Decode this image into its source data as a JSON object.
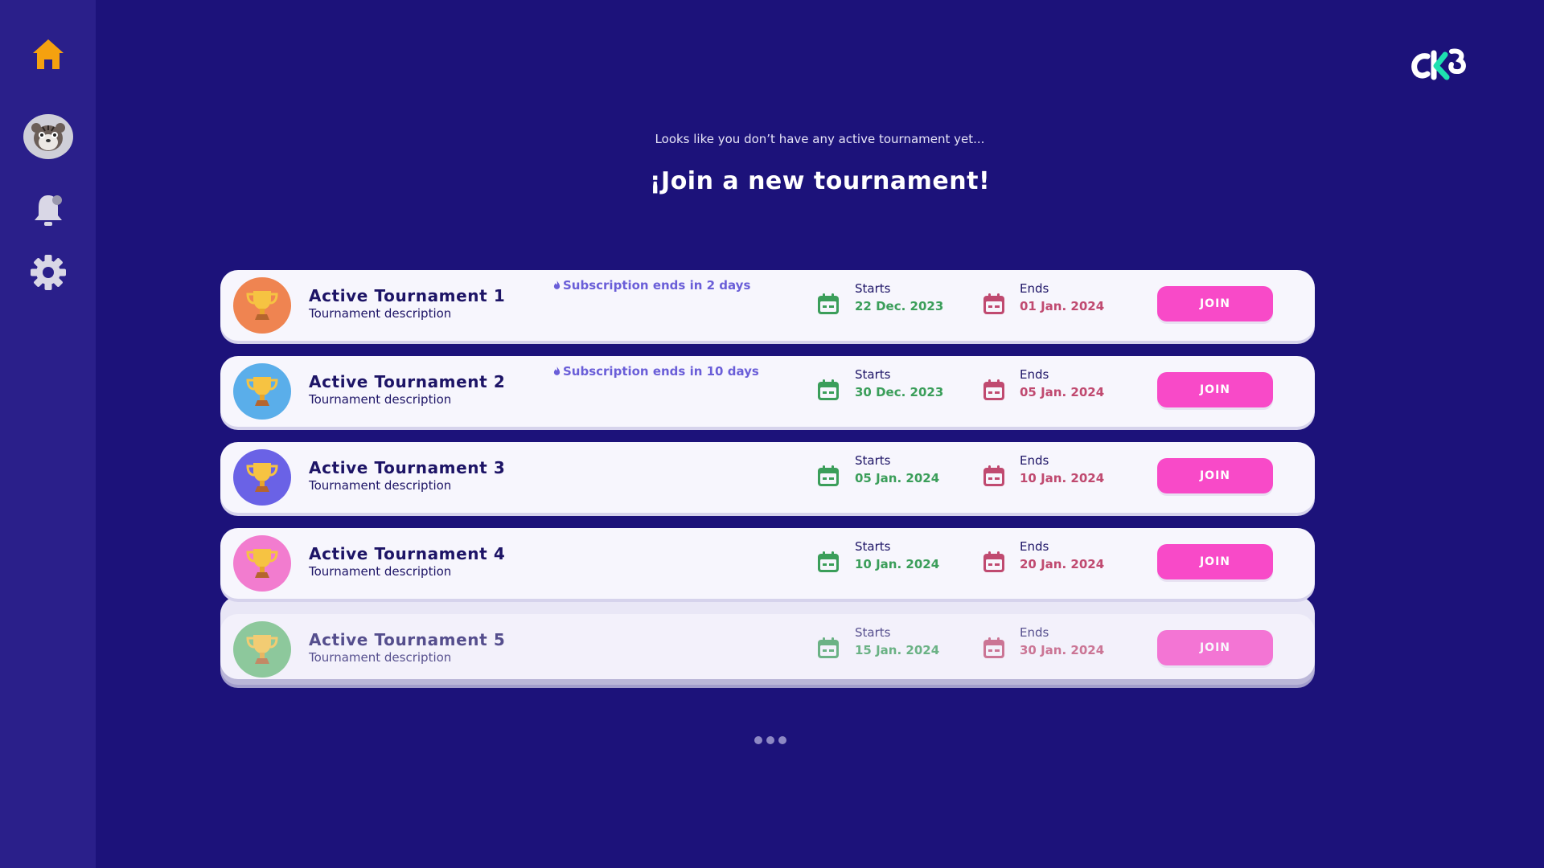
{
  "header": {
    "subtitle": "Looks like you don’t have any active tournament yet...",
    "title": "¡Join a new tournament!"
  },
  "sidebar": {
    "items": [
      {
        "name": "home",
        "icon": "home-icon",
        "color": "#f5a10f"
      },
      {
        "name": "profile",
        "icon": "tiger-avatar-icon"
      },
      {
        "name": "notifications",
        "icon": "bell-icon",
        "color": "#d9d7e6"
      },
      {
        "name": "settings",
        "icon": "gear-icon",
        "color": "#d9d7e6"
      }
    ]
  },
  "logo": {
    "icon": "ck-logo-icon"
  },
  "labels": {
    "starts": "Starts",
    "ends": "Ends",
    "join": "JOIN"
  },
  "tournaments": [
    {
      "title": "Active Tournament 1",
      "description": "Tournament description",
      "subscription_note": "Subscription ends in 2 days",
      "starts": "22 Dec. 2023",
      "ends": "01 Jan. 2024",
      "color": "#ef8451"
    },
    {
      "title": "Active Tournament 2",
      "description": "Tournament description",
      "subscription_note": "Subscription ends in 10 days",
      "starts": "30 Dec. 2023",
      "ends": "05 Jan. 2024",
      "color": "#5aaeea"
    },
    {
      "title": "Active Tournament 3",
      "description": "Tournament description",
      "subscription_note": "",
      "starts": "05 Jan. 2024",
      "ends": "10 Jan. 2024",
      "color": "#6a62e6"
    },
    {
      "title": "Active Tournament 4",
      "description": "Tournament description",
      "subscription_note": "",
      "starts": "10 Jan. 2024",
      "ends": "20 Jan. 2024",
      "color": "#f27ccf"
    },
    {
      "title": "Active Tournament 5",
      "description": "Tournament description",
      "subscription_note": "",
      "starts": "15 Jan. 2024",
      "ends": "30 Jan. 2024",
      "color": "#6bbd7a"
    }
  ],
  "colors": {
    "background": "#1c127a",
    "sidebar": "#2a1f8a",
    "join_button": "#f84ac8",
    "start_date": "#3b9e5a",
    "end_date": "#c04a70",
    "accent_note": "#6a5ed8"
  },
  "pagination": {
    "pages": 3
  }
}
